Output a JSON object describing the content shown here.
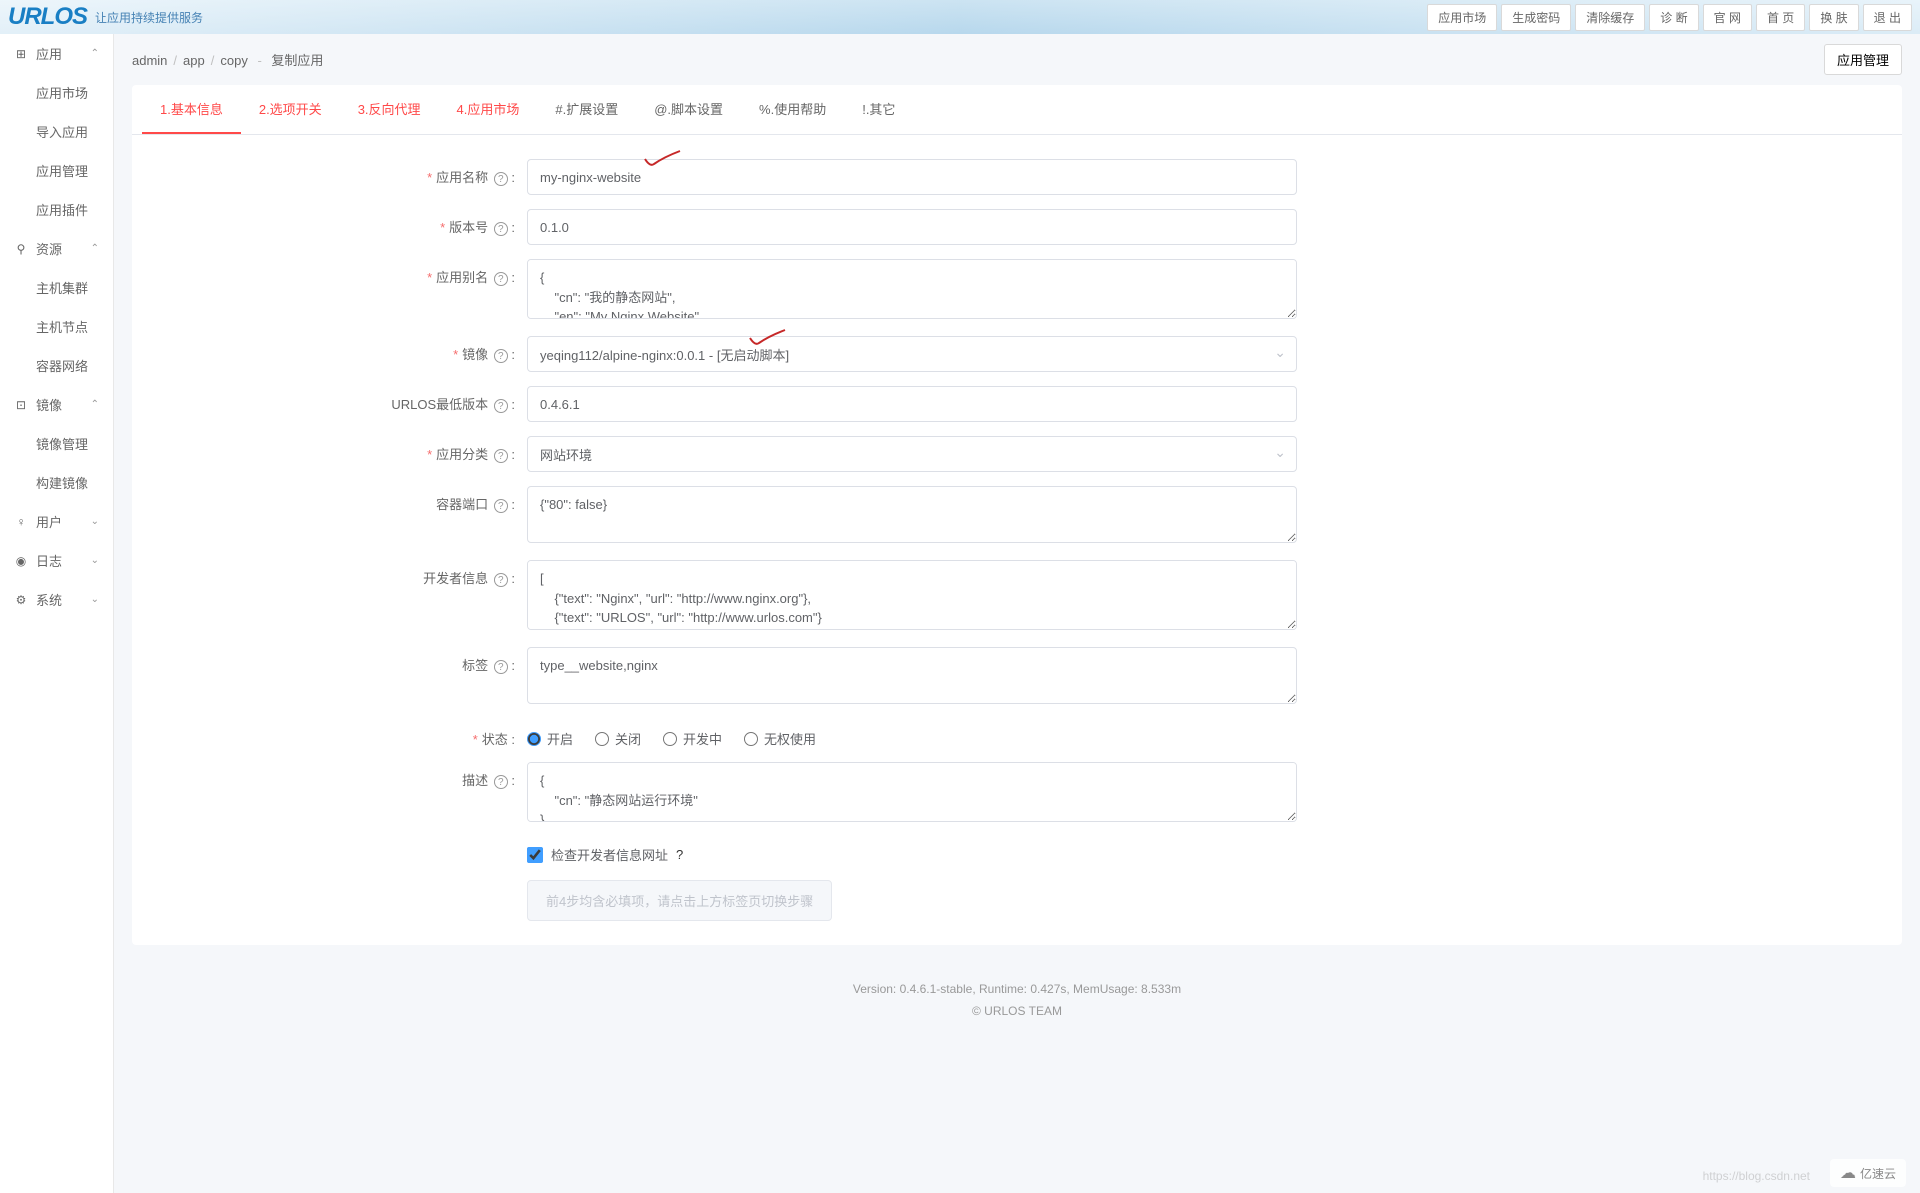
{
  "header": {
    "logo": "URLOS",
    "tagline": "让应用持续提供服务",
    "buttons": [
      "应用市场",
      "生成密码",
      "清除缓存",
      "诊 断",
      "官 网",
      "首 页",
      "换 肤",
      "退 出"
    ]
  },
  "sidebar": {
    "groups": [
      {
        "icon": "⊞",
        "label": "应用",
        "expanded": true,
        "children": [
          "应用市场",
          "导入应用",
          "应用管理",
          "应用插件"
        ]
      },
      {
        "icon": "⚲",
        "label": "资源",
        "expanded": true,
        "children": [
          "主机集群",
          "主机节点",
          "容器网络"
        ]
      },
      {
        "icon": "⊡",
        "label": "镜像",
        "expanded": true,
        "children": [
          "镜像管理",
          "构建镜像"
        ]
      },
      {
        "icon": "♀",
        "label": "用户",
        "expanded": false,
        "children": []
      },
      {
        "icon": "◉",
        "label": "日志",
        "expanded": false,
        "children": []
      },
      {
        "icon": "⚙",
        "label": "系统",
        "expanded": false,
        "children": []
      }
    ]
  },
  "breadcrumb": {
    "parts": [
      "admin",
      "app",
      "copy"
    ],
    "suffix": "复制应用"
  },
  "mgmt_button": "应用管理",
  "tabs": [
    "1.基本信息",
    "2.选项开关",
    "3.反向代理",
    "4.应用市场",
    "#.扩展设置",
    "@.脚本设置",
    "%.使用帮助",
    "!.其它"
  ],
  "active_tab_index": 0,
  "colored_tabs": [
    1,
    2,
    3
  ],
  "form": {
    "app_name": {
      "label": "应用名称",
      "value": "my-nginx-website",
      "required": true,
      "help": true
    },
    "version": {
      "label": "版本号",
      "value": "0.1.0",
      "required": true,
      "help": true
    },
    "alias": {
      "label": "应用别名",
      "value": "{\n    \"cn\": \"我的静态网站\",\n    \"en\": \"My Nginx Website\"\n}",
      "required": true,
      "help": true
    },
    "image": {
      "label": "镜像",
      "value": "yeqing112/alpine-nginx:0.0.1 - [无启动脚本]",
      "required": true,
      "help": true
    },
    "urlos_min": {
      "label": "URLOS最低版本",
      "value": "0.4.6.1",
      "required": false,
      "help": true
    },
    "category": {
      "label": "应用分类",
      "value": "网站环境",
      "required": true,
      "help": true
    },
    "ports": {
      "label": "容器端口",
      "value": "{\"80\": false}",
      "required": false,
      "help": true
    },
    "developer": {
      "label": "开发者信息",
      "value": "[\n    {\"text\": \"Nginx\", \"url\": \"http://www.nginx.org\"},\n    {\"text\": \"URLOS\", \"url\": \"http://www.urlos.com\"}\n]",
      "required": false,
      "help": true
    },
    "tags": {
      "label": "标签",
      "value": "type__website,nginx",
      "required": false,
      "help": true
    },
    "status": {
      "label": "状态",
      "required": true,
      "options": [
        "开启",
        "关闭",
        "开发中",
        "无权使用"
      ],
      "selected": 0
    },
    "description": {
      "label": "描述",
      "value": "{\n    \"cn\": \"静态网站运行环境\"\n}",
      "required": false,
      "help": true
    },
    "check_dev": {
      "label": "检查开发者信息网址",
      "checked": true,
      "help": true
    },
    "disabled_hint": "前4步均含必填项，请点击上方标签页切换步骤"
  },
  "footer": {
    "line1": "Version: 0.4.6.1-stable,   Runtime: 0.427s,   MemUsage: 8.533m",
    "line2": "© URLOS TEAM"
  },
  "watermark": "亿速云",
  "blog_watermark": "https://blog.csdn.net"
}
